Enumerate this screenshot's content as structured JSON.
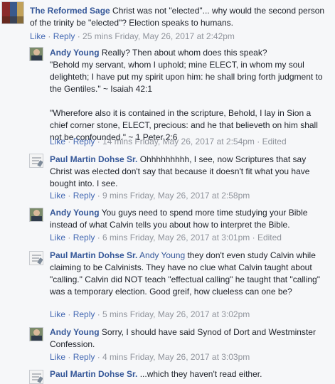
{
  "comments": [
    {
      "author": "The Reformed Sage",
      "text": "Christ was not \"elected\"... why would the second person of the trinity be \"elected\"? Election speaks to humans.",
      "like": "Like",
      "reply": "Reply",
      "time": "25 mins Friday, May 26, 2017 at 2:42pm",
      "edited": ""
    },
    {
      "author": "Andy Young",
      "text": "Really? Then about whom does this speak?\n\"Behold my servant, whom I uphold; mine ELECT, in whom my soul delighteth; I have put my spirit upon him: he shall bring forth judgment to the Gentiles.\" ~ Isaiah 42:1\n\n\"Wherefore also it is contained in the scripture, Behold, I lay in Sion a chief corner stone, ELECT, precious: and he that believeth on him shall not be confounded.\" ~ 1 Peter 2:6",
      "like": "Like",
      "reply": "Reply",
      "time": "14 mins Friday, May 26, 2017 at 2:54pm",
      "edited": "Edited"
    },
    {
      "author": "Paul Martin Dohse Sr.",
      "text": "Ohhhhhhhhh, I see, now Scriptures that say Christ was elected don't say that because it doesn't fit what you have bought into. I see.",
      "like": "Like",
      "reply": "Reply",
      "time": "9 mins Friday, May 26, 2017 at 2:58pm",
      "edited": ""
    },
    {
      "author": "Andy Young",
      "text": "You guys need to spend more time studying your Bible instead of what Calvin tells you about how to interpret the Bible.",
      "like": "Like",
      "reply": "Reply",
      "time": "6 mins Friday, May 26, 2017 at 3:01pm",
      "edited": "Edited"
    },
    {
      "author": "Paul Martin Dohse Sr.",
      "mention": "Andy Young",
      "text": "they don't even study Calvin while claiming to be Calvinists. They have no clue what Calvin taught about \"calling.\" Calvin did NOT teach \"effectual calling\" he taught that \"calling\" was a temporary election. Good greif, how clueless can one be?",
      "like": "Like",
      "reply": "Reply",
      "time": "5 mins Friday, May 26, 2017 at 3:02pm",
      "edited": ""
    },
    {
      "author": "Andy Young",
      "text": "Sorry, I should have said Synod of Dort and Westminster Confession.",
      "like": "Like",
      "reply": "Reply",
      "time": "4 mins Friday, May 26, 2017 at 3:03pm",
      "edited": ""
    },
    {
      "author": "Paul Martin Dohse Sr.",
      "text": "...which they haven't read either.",
      "like": "",
      "reply": "",
      "time": "",
      "edited": ""
    }
  ]
}
